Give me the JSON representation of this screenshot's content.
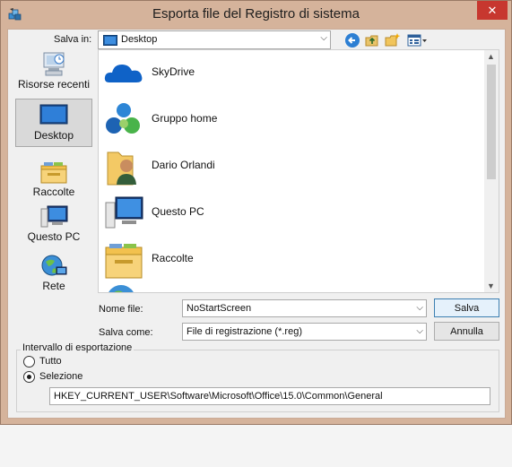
{
  "window": {
    "title": "Esporta file del Registro di sistema",
    "close_glyph": "✕",
    "app_icon": "registry-editor-icon"
  },
  "location": {
    "label": "Salva in:",
    "value": "Desktop",
    "dropdown_glyph": "⌵"
  },
  "toolbar": {
    "back_icon": "back-arrow-icon",
    "up_icon": "up-folder-icon",
    "new_folder_icon": "new-folder-icon",
    "view_menu_icon": "view-menu-icon"
  },
  "places": [
    {
      "label": "Risorse recenti",
      "icon": "recent-places-icon"
    },
    {
      "label": "Desktop",
      "icon": "desktop-icon",
      "selected": true
    },
    {
      "label": "Raccolte",
      "icon": "libraries-icon"
    },
    {
      "label": "Questo PC",
      "icon": "this-pc-icon"
    },
    {
      "label": "Rete",
      "icon": "network-icon"
    }
  ],
  "files": [
    {
      "label": "SkyDrive",
      "icon": "skydrive-cloud-icon"
    },
    {
      "label": "Gruppo home",
      "icon": "homegroup-icon"
    },
    {
      "label": "Dario Orlandi",
      "icon": "user-folder-icon"
    },
    {
      "label": "Questo PC",
      "icon": "computer-icon"
    },
    {
      "label": "Raccolte",
      "icon": "libraries-folder-icon"
    }
  ],
  "filename": {
    "label": "Nome file:",
    "value": "NoStartScreen"
  },
  "filetype": {
    "label": "Salva come:",
    "value": "File di registrazione (*.reg)"
  },
  "buttons": {
    "save": "Salva",
    "cancel": "Annulla"
  },
  "export_range": {
    "label": "Intervallo di esportazione",
    "options": [
      {
        "label": "Tutto",
        "selected": false
      },
      {
        "label": "Selezione",
        "selected": true
      }
    ],
    "branch": "HKEY_CURRENT_USER\\Software\\Microsoft\\Office\\15.0\\Common\\General"
  },
  "colors": {
    "frame": "#d5b39b",
    "close": "#c7372f",
    "client": "#f0f0f0"
  }
}
